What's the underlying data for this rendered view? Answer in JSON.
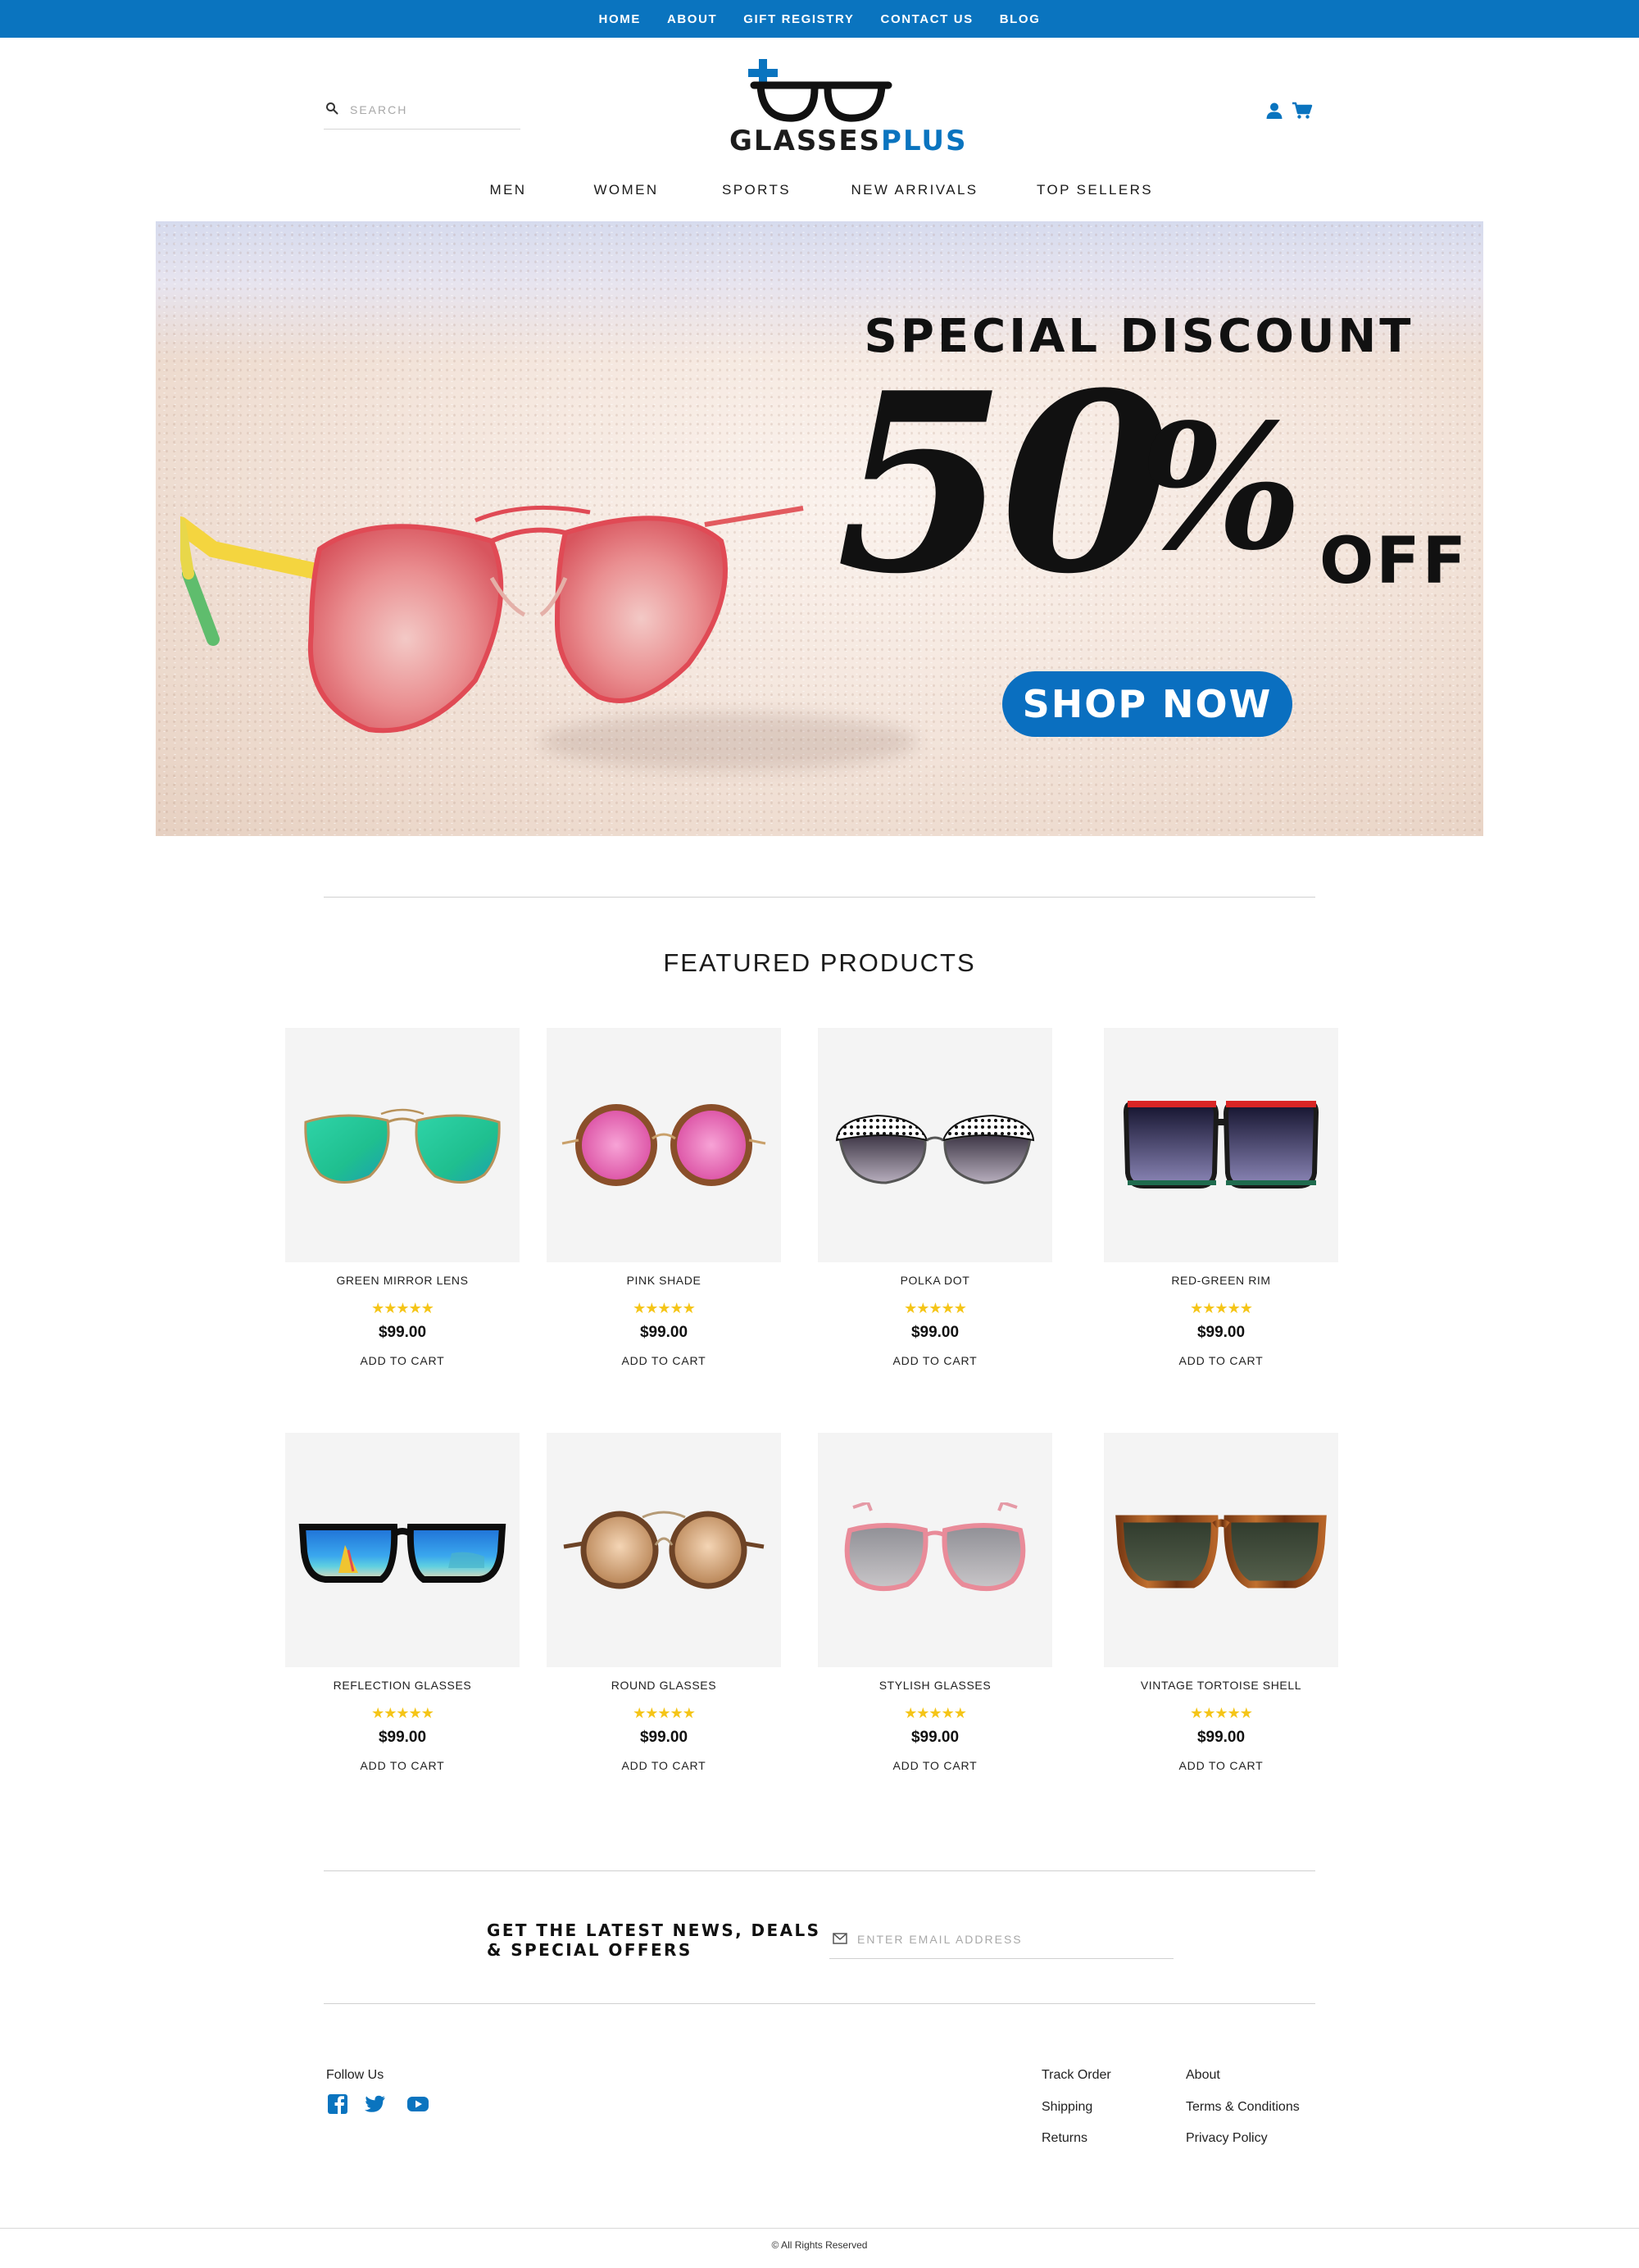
{
  "topnav": {
    "items": [
      "HOME",
      "ABOUT",
      "GIFT REGISTRY",
      "CONTACT US",
      "BLOG"
    ]
  },
  "header": {
    "search_placeholder": "SEARCH",
    "logo_part1": "GLASSES",
    "logo_part2": "PLUS",
    "icons": [
      "search-icon",
      "user-icon",
      "cart-icon",
      "glasses-logo"
    ]
  },
  "mainnav": {
    "items": [
      "MEN",
      "WOMEN",
      "SPORTS",
      "NEW ARRIVALS",
      "TOP SELLERS"
    ]
  },
  "hero": {
    "title": "SPECIAL DISCOUNT",
    "amount": "50",
    "percent": "%",
    "off": "OFF",
    "cta": "SHOP NOW"
  },
  "featured": {
    "title": "FEATURED PRODUCTS",
    "products": [
      {
        "name": "GREEN MIRROR LENS",
        "stars": "★★★★★",
        "rating": 5,
        "price": "$99.00",
        "cart": "ADD TO CART"
      },
      {
        "name": "PINK SHADE",
        "stars": "★★★★★",
        "rating": 5,
        "price": "$99.00",
        "cart": "ADD TO CART"
      },
      {
        "name": "POLKA DOT",
        "stars": "★★★★★",
        "rating": 5,
        "price": "$99.00",
        "cart": "ADD TO CART"
      },
      {
        "name": "RED-GREEN RIM",
        "stars": "★★★★★",
        "rating": 5,
        "price": "$99.00",
        "cart": "ADD TO CART"
      },
      {
        "name": "REFLECTION GLASSES",
        "stars": "★★★★★",
        "rating": 5,
        "price": "$99.00",
        "cart": "ADD TO CART"
      },
      {
        "name": "ROUND GLASSES",
        "stars": "★★★★★",
        "rating": 5,
        "price": "$99.00",
        "cart": "ADD TO CART"
      },
      {
        "name": "STYLISH GLASSES",
        "stars": "★★★★★",
        "rating": 5,
        "price": "$99.00",
        "cart": "ADD TO CART"
      },
      {
        "name": "VINTAGE TORTOISE SHELL",
        "stars": "★★★★★",
        "rating": 5,
        "price": "$99.00",
        "cart": "ADD TO CART"
      }
    ]
  },
  "newsletter": {
    "title_line1": "GET THE LATEST NEWS, DEALS",
    "title_line2": "& SPECIAL OFFERS",
    "placeholder": "ENTER EMAIL ADDRESS"
  },
  "footer": {
    "follow": "Follow Us",
    "social": [
      "facebook-icon",
      "twitter-icon",
      "youtube-icon"
    ],
    "col1": [
      "Track Order",
      "Shipping",
      "Returns"
    ],
    "col2": [
      "About",
      "Terms & Conditions",
      "Privacy Policy"
    ],
    "copyright": "© All Rights Reserved"
  },
  "colors": {
    "brand_blue": "#0a74bf",
    "star_gold": "#f5c518",
    "product_bg": "#f4f4f4"
  }
}
